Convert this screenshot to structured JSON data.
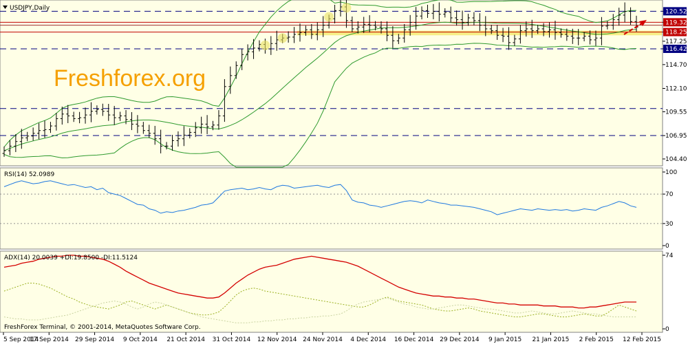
{
  "colors": {
    "panel_bg": "#ffffe6",
    "price_bar": "#000000",
    "band": "#2e9a2e",
    "level_line": "#000080",
    "support_line": "#c00000",
    "zone_fill": "#f6ec7a",
    "rsi_line": "#1e78e0",
    "adx_line": "#d40000",
    "di_line": "#9ab020",
    "arrow": "#d40000",
    "watermark": "#f5a000",
    "highlight": "#e8e060",
    "price_label_blue": "#000080",
    "price_label_red": "#c00000"
  },
  "chart_data": [
    {
      "type": "ohlc",
      "title": "USDJPY,Daily",
      "watermark": "Freshforex.org",
      "ylim": [
        103.8,
        121.6
      ],
      "y_ticks": [
        "120.52",
        "119.32",
        "118.25",
        "117.25",
        "116.42",
        "114.70",
        "112.10",
        "109.55",
        "106.95",
        "104.40"
      ],
      "price_labels": [
        {
          "value": "120.52",
          "style": "blue"
        },
        {
          "value": "119.32",
          "style": "red"
        },
        {
          "value": "118.25",
          "style": "red"
        },
        {
          "value": "116.42",
          "style": "blue"
        }
      ],
      "dashed_levels": [
        120.52,
        116.42,
        109.9,
        106.95
      ],
      "red_levels": [
        119.32,
        118.25
      ],
      "zone": [
        117.9,
        118.4
      ],
      "closes": [
        105.3,
        105.8,
        106.3,
        106.7,
        106.9,
        107.2,
        107.5,
        107.6,
        108.0,
        108.8,
        109.3,
        109.1,
        108.8,
        108.9,
        109.2,
        109.6,
        109.8,
        109.6,
        109.2,
        108.9,
        109.1,
        108.7,
        108.2,
        108.0,
        107.5,
        107.2,
        106.6,
        105.8,
        105.8,
        106.4,
        106.6,
        107.0,
        107.3,
        107.8,
        108.2,
        107.9,
        108.1,
        109.1,
        112.3,
        113.5,
        114.6,
        115.8,
        116.1,
        116.5,
        116.9,
        116.4,
        117.0,
        117.4,
        117.6,
        117.7,
        118.0,
        118.2,
        118.5,
        118.0,
        118.5,
        119.0,
        119.7,
        120.6,
        121.0,
        119.5,
        118.6,
        118.8,
        119.1,
        119.0,
        118.8,
        118.6,
        117.9,
        117.3,
        117.6,
        118.5,
        119.3,
        120.0,
        120.6,
        120.3,
        120.5,
        120.2,
        120.4,
        119.8,
        119.6,
        119.3,
        119.8,
        119.5,
        119.0,
        118.6,
        118.4,
        117.9,
        117.8,
        117.1,
        117.5,
        118.4,
        118.6,
        118.4,
        118.6,
        118.3,
        118.5,
        118.2,
        118.0,
        117.8,
        117.6,
        117.6,
        117.8,
        117.4,
        117.6,
        118.9,
        119.0,
        119.6,
        120.1,
        120.5,
        119.4,
        118.8
      ]
    },
    {
      "type": "line",
      "title": "RSI(14) 52.0989",
      "ylim": [
        0,
        100
      ],
      "y_ticks": [
        "100",
        "70",
        "30",
        "0"
      ],
      "levels": [
        70,
        30
      ],
      "series": [
        {
          "values": [
            80,
            83,
            86,
            88,
            86,
            84,
            85,
            87,
            88,
            86,
            84,
            82,
            83,
            81,
            79,
            80,
            76,
            78,
            72,
            70,
            68,
            64,
            60,
            56,
            55,
            50,
            48,
            44,
            46,
            45,
            47,
            48,
            50,
            52,
            55,
            56,
            58,
            66,
            74,
            76,
            77,
            78,
            76,
            77,
            79,
            77,
            76,
            80,
            82,
            81,
            78,
            79,
            80,
            81,
            82,
            80,
            79,
            82,
            83,
            75,
            62,
            59,
            58,
            55,
            54,
            52,
            54,
            56,
            58,
            60,
            61,
            60,
            58,
            62,
            60,
            58,
            57,
            55,
            55,
            54,
            53,
            52,
            50,
            48,
            46,
            42,
            44,
            46,
            48,
            50,
            49,
            48,
            50,
            49,
            48,
            49,
            48,
            49,
            47,
            48,
            50,
            49,
            48,
            52,
            54,
            57,
            60,
            58,
            54,
            52
          ]
        }
      ]
    },
    {
      "type": "line",
      "title": "ADX(14) 20.0039 +DI:19.8500 -DI:11.5124",
      "ylim": [
        0,
        74
      ],
      "y_ticks": [
        "74",
        "0"
      ],
      "series": [
        {
          "values": [
            62,
            63,
            64,
            66,
            67,
            68,
            70,
            71,
            72,
            73,
            73,
            74,
            74,
            73,
            73,
            72,
            71,
            70,
            68,
            65,
            62,
            58,
            55,
            52,
            49,
            46,
            44,
            42,
            40,
            38,
            36,
            35,
            34,
            33,
            32,
            31,
            31,
            32,
            36,
            41,
            46,
            50,
            54,
            57,
            60,
            62,
            63,
            64,
            66,
            68,
            70,
            71,
            72,
            73,
            72,
            71,
            70,
            69,
            68,
            67,
            65,
            63,
            60,
            57,
            54,
            51,
            48,
            45,
            42,
            40,
            38,
            36,
            35,
            34,
            33,
            33,
            32,
            32,
            31,
            31,
            30,
            30,
            29,
            28,
            27,
            26,
            26,
            25,
            25,
            24,
            24,
            24,
            24,
            23,
            23,
            23,
            22,
            22,
            22,
            21,
            21,
            22,
            22,
            23,
            24,
            25,
            26,
            27,
            27,
            27
          ]
        },
        {
          "values": [
            38,
            40,
            42,
            44,
            46,
            46,
            45,
            43,
            41,
            38,
            35,
            32,
            30,
            27,
            25,
            23,
            22,
            21,
            20,
            22,
            24,
            27,
            28,
            26,
            24,
            22,
            20,
            22,
            24,
            22,
            20,
            18,
            16,
            15,
            14,
            14,
            15,
            17,
            22,
            28,
            34,
            38,
            40,
            41,
            40,
            38,
            37,
            36,
            35,
            34,
            33,
            32,
            31,
            30,
            29,
            28,
            27,
            26,
            25,
            24,
            23,
            22,
            22,
            24,
            27,
            30,
            32,
            30,
            28,
            27,
            26,
            25,
            24,
            22,
            20,
            19,
            18,
            18,
            19,
            20,
            21,
            20,
            18,
            17,
            16,
            15,
            14,
            13,
            12,
            12,
            13,
            14,
            15,
            15,
            14,
            13,
            12,
            12,
            13,
            14,
            15,
            14,
            13,
            13,
            16,
            20,
            24,
            22,
            20,
            18
          ]
        },
        {
          "values": [
            12,
            11,
            10,
            10,
            9,
            9,
            9,
            10,
            11,
            12,
            13,
            14,
            16,
            18,
            20,
            22,
            24,
            26,
            27,
            28,
            27,
            25,
            22,
            20,
            22,
            25,
            27,
            26,
            24,
            22,
            20,
            18,
            16,
            14,
            12,
            11,
            10,
            9,
            8,
            7,
            6,
            6,
            6,
            7,
            7,
            8,
            8,
            9,
            9,
            10,
            10,
            11,
            11,
            12,
            12,
            13,
            13,
            14,
            15,
            18,
            22,
            25,
            27,
            28,
            29,
            30,
            31,
            29,
            27,
            25,
            24,
            22,
            21,
            20,
            20,
            21,
            22,
            23,
            24,
            24,
            23,
            22,
            21,
            20,
            20,
            19,
            18,
            17,
            16,
            16,
            17,
            18,
            17,
            16,
            15,
            15,
            16,
            17,
            18,
            17,
            16,
            15,
            15,
            14,
            13,
            12,
            12,
            12,
            12,
            12
          ]
        }
      ]
    }
  ],
  "x_axis": {
    "labels": [
      "5 Sep 2014",
      "17 Sep 2014",
      "29 Sep 2014",
      "9 Oct 2014",
      "21 Oct 2014",
      "31 Oct 2014",
      "12 Nov 2014",
      "24 Nov 2014",
      "4 Dec 2014",
      "16 Dec 2014",
      "29 Dec 2014",
      "9 Jan 2015",
      "21 Jan 2015",
      "2 Feb 2015",
      "12 Feb 2015"
    ]
  },
  "footer": {
    "copyright": "FreshForex Terminal, © 2001-2014, MetaQuotes Software Corp."
  },
  "icons": {
    "menu": "triangle-down-icon",
    "trend_arrow": "arrow-up-right-icon"
  }
}
